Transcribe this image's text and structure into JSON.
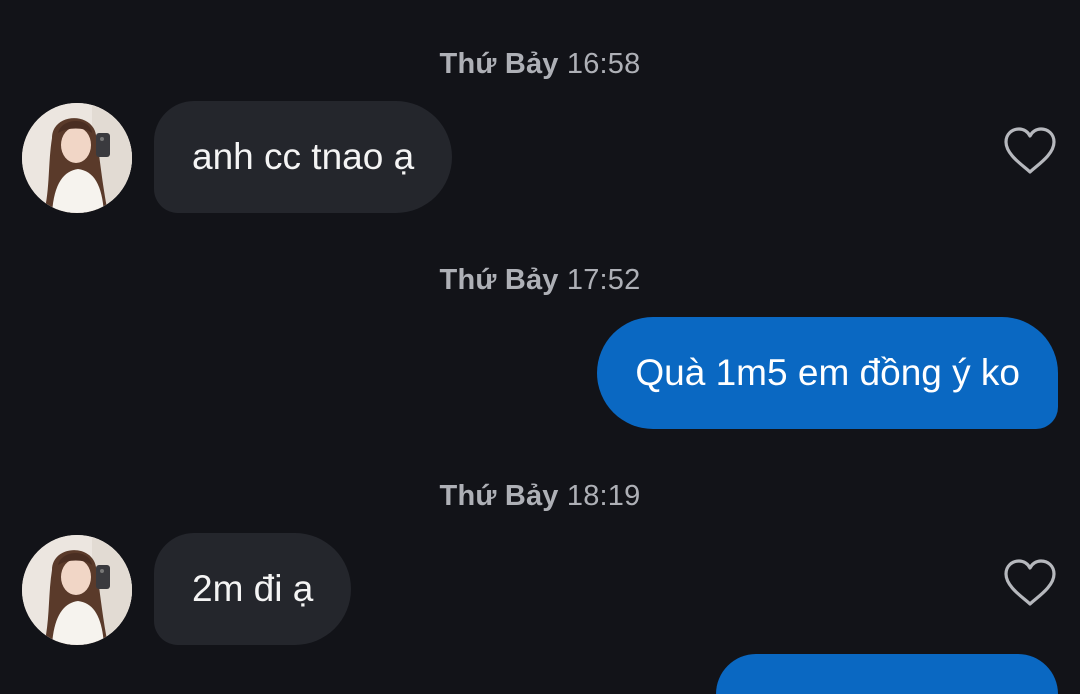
{
  "colors": {
    "background": "#121318",
    "incoming_bubble": "#24262c",
    "outgoing_bubble": "#0a68c2",
    "timestamp_text": "#aeb0b6"
  },
  "messages": [
    {
      "timestamp": {
        "day": "Thứ Bảy",
        "time": "16:58"
      },
      "direction": "incoming",
      "text": "anh cc tnao ạ",
      "avatar_icon": "profile-photo",
      "like_icon": "heart-outline-icon"
    },
    {
      "timestamp": {
        "day": "Thứ Bảy",
        "time": "17:52"
      },
      "direction": "outgoing",
      "text": "Quà 1m5 em đồng ý ko"
    },
    {
      "timestamp": {
        "day": "Thứ Bảy",
        "time": "18:19"
      },
      "direction": "incoming",
      "text": "2m đi ạ",
      "avatar_icon": "profile-photo",
      "like_icon": "heart-outline-icon"
    }
  ]
}
